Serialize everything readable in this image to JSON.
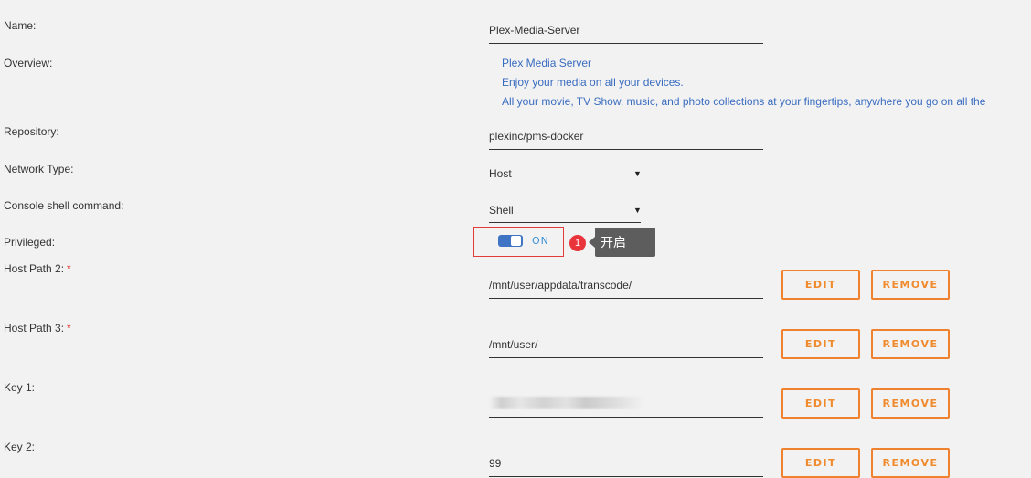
{
  "labels": {
    "name": "Name:",
    "overview": "Overview:",
    "repository": "Repository:",
    "network_type": "Network Type:",
    "console": "Console shell command:",
    "privileged": "Privileged:",
    "host_path_2": "Host Path 2:",
    "host_path_3": "Host Path 3:",
    "key_1": "Key 1:",
    "key_2": "Key 2:",
    "required_mark": "*"
  },
  "fields": {
    "name": "Plex-Media-Server",
    "repository": "plexinc/pms-docker",
    "network_type": "Host",
    "console": "Shell",
    "host_path_2": "/mnt/user/appdata/transcode/",
    "host_path_3": "/mnt/user/",
    "key_2": "99"
  },
  "overview_lines": [
    "Plex Media Server",
    "Enjoy your media on all your devices.",
    "All your movie, TV Show, music, and photo collections at your fingertips, anywhere you go on all the"
  ],
  "privileged": {
    "state": "ON",
    "on": true
  },
  "annotation": {
    "badge": "1",
    "tooltip": "开启"
  },
  "buttons": {
    "edit": "EDIT",
    "remove": "REMOVE"
  },
  "colors": {
    "accent_orange": "#f0822f",
    "toggle_blue": "#3f74c4",
    "link_blue": "#3a6cc0",
    "highlight_red": "#e53a3a"
  }
}
